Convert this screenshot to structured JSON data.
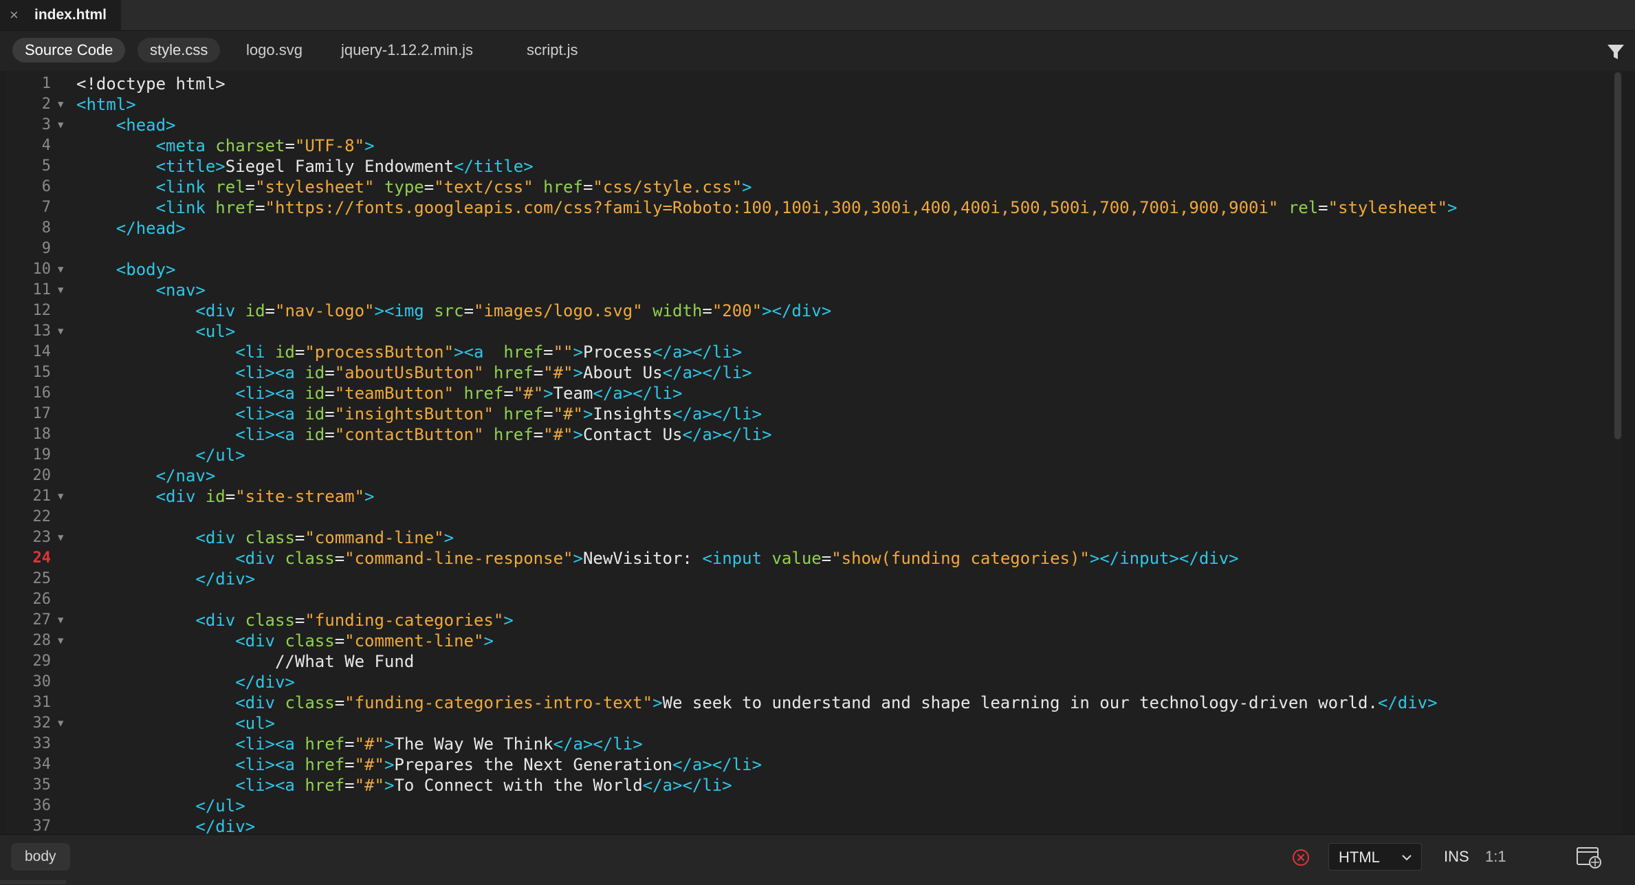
{
  "tab": {
    "filename": "index.html"
  },
  "related_files": [
    "Source Code",
    "style.css",
    "logo.svg",
    "jquery-1.12.2.min.js",
    "script.js"
  ],
  "current_line": 24,
  "code_lines": [
    {
      "n": "1",
      "fold": false,
      "indent": "",
      "tokens": [
        [
          "p",
          "<!doctype html>"
        ]
      ]
    },
    {
      "n": "2",
      "fold": true,
      "indent": "",
      "tokens": [
        [
          "t",
          "<html>"
        ]
      ]
    },
    {
      "n": "3",
      "fold": true,
      "indent": "    ",
      "tokens": [
        [
          "t",
          "<head>"
        ]
      ]
    },
    {
      "n": "4",
      "fold": false,
      "indent": "        ",
      "tokens": [
        [
          "t",
          "<meta "
        ],
        [
          "a",
          "charset"
        ],
        [
          "p",
          "="
        ],
        [
          "s",
          "\"UTF-8\""
        ],
        [
          "t",
          ">"
        ]
      ]
    },
    {
      "n": "5",
      "fold": false,
      "indent": "        ",
      "tokens": [
        [
          "t",
          "<title>"
        ],
        [
          "p",
          "Siegel Family Endowment"
        ],
        [
          "t",
          "</title>"
        ]
      ]
    },
    {
      "n": "6",
      "fold": false,
      "indent": "        ",
      "tokens": [
        [
          "t",
          "<link "
        ],
        [
          "a",
          "rel"
        ],
        [
          "p",
          "="
        ],
        [
          "s",
          "\"stylesheet\""
        ],
        [
          "a",
          " type"
        ],
        [
          "p",
          "="
        ],
        [
          "s",
          "\"text/css\""
        ],
        [
          "a",
          " href"
        ],
        [
          "p",
          "="
        ],
        [
          "s",
          "\"css/style.css\""
        ],
        [
          "t",
          ">"
        ]
      ]
    },
    {
      "n": "7",
      "fold": false,
      "indent": "        ",
      "tokens": [
        [
          "t",
          "<link "
        ],
        [
          "a",
          "href"
        ],
        [
          "p",
          "="
        ],
        [
          "s",
          "\"https://fonts.googleapis.com/css?family=Roboto:100,100i,300,300i,400,400i,500,500i,700,700i,900,900i\""
        ],
        [
          "a",
          " rel"
        ],
        [
          "p",
          "="
        ],
        [
          "s",
          "\"stylesheet\""
        ],
        [
          "t",
          ">"
        ]
      ]
    },
    {
      "n": "8",
      "fold": false,
      "indent": "    ",
      "tokens": [
        [
          "t",
          "</head>"
        ]
      ]
    },
    {
      "n": "9",
      "fold": false,
      "indent": "",
      "tokens": []
    },
    {
      "n": "10",
      "fold": true,
      "indent": "    ",
      "tokens": [
        [
          "t",
          "<body>"
        ]
      ]
    },
    {
      "n": "11",
      "fold": true,
      "indent": "        ",
      "tokens": [
        [
          "t",
          "<nav>"
        ]
      ]
    },
    {
      "n": "12",
      "fold": false,
      "indent": "            ",
      "tokens": [
        [
          "t",
          "<div "
        ],
        [
          "a",
          "id"
        ],
        [
          "p",
          "="
        ],
        [
          "s",
          "\"nav-logo\""
        ],
        [
          "t",
          "><img "
        ],
        [
          "a",
          "src"
        ],
        [
          "p",
          "="
        ],
        [
          "s",
          "\"images/logo.svg\""
        ],
        [
          "a",
          " width"
        ],
        [
          "p",
          "="
        ],
        [
          "s",
          "\"200\""
        ],
        [
          "t",
          "></div>"
        ]
      ]
    },
    {
      "n": "13",
      "fold": true,
      "indent": "            ",
      "tokens": [
        [
          "t",
          "<ul>"
        ]
      ]
    },
    {
      "n": "14",
      "fold": false,
      "indent": "                ",
      "tokens": [
        [
          "t",
          "<li "
        ],
        [
          "a",
          "id"
        ],
        [
          "p",
          "="
        ],
        [
          "s",
          "\"processButton\""
        ],
        [
          "t",
          "><a  "
        ],
        [
          "a",
          "href"
        ],
        [
          "p",
          "="
        ],
        [
          "s",
          "\"\""
        ],
        [
          "t",
          ">"
        ],
        [
          "p",
          "Process"
        ],
        [
          "t",
          "</a></li>"
        ]
      ]
    },
    {
      "n": "15",
      "fold": false,
      "indent": "                ",
      "tokens": [
        [
          "t",
          "<li><a "
        ],
        [
          "a",
          "id"
        ],
        [
          "p",
          "="
        ],
        [
          "s",
          "\"aboutUsButton\""
        ],
        [
          "a",
          " href"
        ],
        [
          "p",
          "="
        ],
        [
          "s",
          "\"#\""
        ],
        [
          "t",
          ">"
        ],
        [
          "p",
          "About Us"
        ],
        [
          "t",
          "</a></li>"
        ]
      ]
    },
    {
      "n": "16",
      "fold": false,
      "indent": "                ",
      "tokens": [
        [
          "t",
          "<li><a "
        ],
        [
          "a",
          "id"
        ],
        [
          "p",
          "="
        ],
        [
          "s",
          "\"teamButton\""
        ],
        [
          "a",
          " href"
        ],
        [
          "p",
          "="
        ],
        [
          "s",
          "\"#\""
        ],
        [
          "t",
          ">"
        ],
        [
          "p",
          "Team"
        ],
        [
          "t",
          "</a></li>"
        ]
      ]
    },
    {
      "n": "17",
      "fold": false,
      "indent": "                ",
      "tokens": [
        [
          "t",
          "<li><a "
        ],
        [
          "a",
          "id"
        ],
        [
          "p",
          "="
        ],
        [
          "s",
          "\"insightsButton\""
        ],
        [
          "a",
          " href"
        ],
        [
          "p",
          "="
        ],
        [
          "s",
          "\"#\""
        ],
        [
          "t",
          ">"
        ],
        [
          "p",
          "Insights"
        ],
        [
          "t",
          "</a></li>"
        ]
      ]
    },
    {
      "n": "18",
      "fold": false,
      "indent": "                ",
      "tokens": [
        [
          "t",
          "<li><a "
        ],
        [
          "a",
          "id"
        ],
        [
          "p",
          "="
        ],
        [
          "s",
          "\"contactButton\""
        ],
        [
          "a",
          " href"
        ],
        [
          "p",
          "="
        ],
        [
          "s",
          "\"#\""
        ],
        [
          "t",
          ">"
        ],
        [
          "p",
          "Contact Us"
        ],
        [
          "t",
          "</a></li>"
        ]
      ]
    },
    {
      "n": "19",
      "fold": false,
      "indent": "            ",
      "tokens": [
        [
          "t",
          "</ul>"
        ]
      ]
    },
    {
      "n": "20",
      "fold": false,
      "indent": "        ",
      "tokens": [
        [
          "t",
          "</nav>"
        ]
      ]
    },
    {
      "n": "21",
      "fold": true,
      "indent": "        ",
      "tokens": [
        [
          "t",
          "<div "
        ],
        [
          "a",
          "id"
        ],
        [
          "p",
          "="
        ],
        [
          "s",
          "\"site-stream\""
        ],
        [
          "t",
          ">"
        ]
      ]
    },
    {
      "n": "22",
      "fold": false,
      "indent": "",
      "tokens": []
    },
    {
      "n": "23",
      "fold": true,
      "indent": "            ",
      "tokens": [
        [
          "t",
          "<div "
        ],
        [
          "a",
          "class"
        ],
        [
          "p",
          "="
        ],
        [
          "s",
          "\"command-line\""
        ],
        [
          "t",
          ">"
        ]
      ]
    },
    {
      "n": "24",
      "fold": false,
      "indent": "                ",
      "tokens": [
        [
          "t",
          "<div "
        ],
        [
          "a",
          "class"
        ],
        [
          "p",
          "="
        ],
        [
          "s",
          "\"command-line-response\""
        ],
        [
          "t",
          ">"
        ],
        [
          "p",
          "NewVisitor: "
        ],
        [
          "t",
          "<input "
        ],
        [
          "a",
          "value"
        ],
        [
          "p",
          "="
        ],
        [
          "s",
          "\"show(funding categories)\""
        ],
        [
          "t",
          "></input></div>"
        ]
      ]
    },
    {
      "n": "25",
      "fold": false,
      "indent": "            ",
      "tokens": [
        [
          "t",
          "</div>"
        ]
      ]
    },
    {
      "n": "26",
      "fold": false,
      "indent": "",
      "tokens": []
    },
    {
      "n": "27",
      "fold": true,
      "indent": "            ",
      "tokens": [
        [
          "t",
          "<div "
        ],
        [
          "a",
          "class"
        ],
        [
          "p",
          "="
        ],
        [
          "s",
          "\"funding-categories\""
        ],
        [
          "t",
          ">"
        ]
      ]
    },
    {
      "n": "28",
      "fold": true,
      "indent": "                ",
      "tokens": [
        [
          "t",
          "<div "
        ],
        [
          "a",
          "class"
        ],
        [
          "p",
          "="
        ],
        [
          "s",
          "\"comment-line\""
        ],
        [
          "t",
          ">"
        ]
      ]
    },
    {
      "n": "29",
      "fold": false,
      "indent": "                    ",
      "tokens": [
        [
          "p",
          "//What We Fund"
        ]
      ]
    },
    {
      "n": "30",
      "fold": false,
      "indent": "                ",
      "tokens": [
        [
          "t",
          "</div>"
        ]
      ]
    },
    {
      "n": "31",
      "fold": false,
      "indent": "                ",
      "tokens": [
        [
          "t",
          "<div "
        ],
        [
          "a",
          "class"
        ],
        [
          "p",
          "="
        ],
        [
          "s",
          "\"funding-categories-intro-text\""
        ],
        [
          "t",
          ">"
        ],
        [
          "p",
          "We seek to understand and shape learning in our technology-driven world."
        ],
        [
          "t",
          "</div>"
        ]
      ]
    },
    {
      "n": "32",
      "fold": true,
      "indent": "                ",
      "tokens": [
        [
          "t",
          "<ul>"
        ]
      ]
    },
    {
      "n": "33",
      "fold": false,
      "indent": "                ",
      "tokens": [
        [
          "t",
          "<li><a "
        ],
        [
          "a",
          "href"
        ],
        [
          "p",
          "="
        ],
        [
          "s",
          "\"#\""
        ],
        [
          "t",
          ">"
        ],
        [
          "p",
          "The Way We Think"
        ],
        [
          "t",
          "</a></li>"
        ]
      ]
    },
    {
      "n": "34",
      "fold": false,
      "indent": "                ",
      "tokens": [
        [
          "t",
          "<li><a "
        ],
        [
          "a",
          "href"
        ],
        [
          "p",
          "="
        ],
        [
          "s",
          "\"#\""
        ],
        [
          "t",
          ">"
        ],
        [
          "p",
          "Prepares the Next Generation"
        ],
        [
          "t",
          "</a></li>"
        ]
      ]
    },
    {
      "n": "35",
      "fold": false,
      "indent": "                ",
      "tokens": [
        [
          "t",
          "<li><a "
        ],
        [
          "a",
          "href"
        ],
        [
          "p",
          "="
        ],
        [
          "s",
          "\"#\""
        ],
        [
          "t",
          ">"
        ],
        [
          "p",
          "To Connect with the World"
        ],
        [
          "t",
          "</a></li>"
        ]
      ]
    },
    {
      "n": "36",
      "fold": false,
      "indent": "            ",
      "tokens": [
        [
          "t",
          "</ul>"
        ]
      ]
    },
    {
      "n": "37",
      "fold": false,
      "indent": "            ",
      "tokens": [
        [
          "t",
          "</div>"
        ]
      ]
    }
  ],
  "status": {
    "tag": "body",
    "language": "HTML",
    "mode": "INS",
    "position": "1:1"
  },
  "colors": {
    "tag": "#2ec7e8",
    "attribute": "#8fd14f",
    "string": "#f0a93b",
    "text": "#e8e8e8",
    "current_line_number": "#e3343a",
    "error": "#e3343a"
  },
  "icons": {
    "close": "close-icon",
    "filter": "filter-icon",
    "fold": "fold-arrow-icon",
    "error": "error-icon",
    "dropdown": "chevron-down-icon",
    "preview": "live-preview-icon"
  }
}
